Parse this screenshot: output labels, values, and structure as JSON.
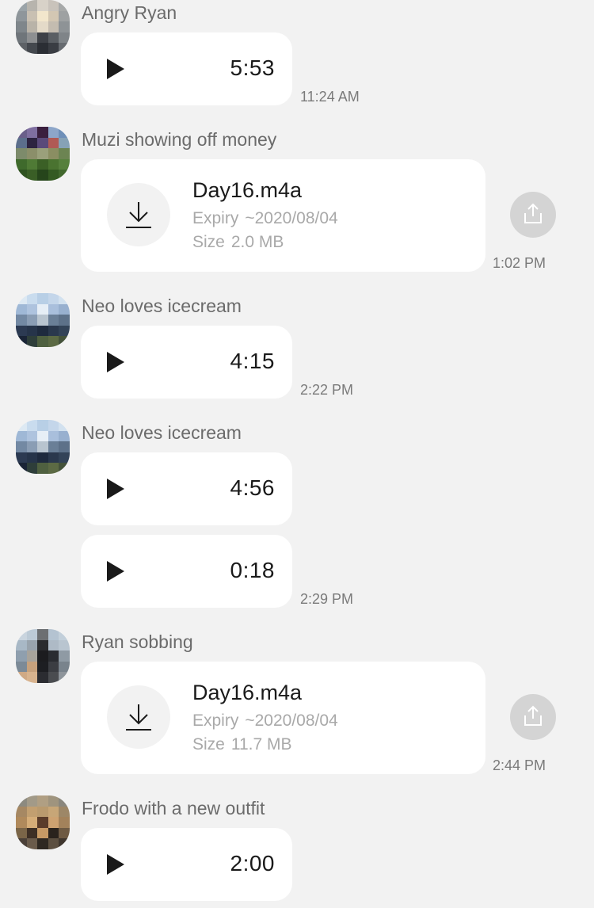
{
  "messages": [
    {
      "sender": "Angry Ryan",
      "duration": "5:53",
      "time": "11:24 AM"
    },
    {
      "sender": "Muzi showing off money",
      "file_name": "Day16.m4a",
      "expiry_label": "Expiry",
      "expiry_value": "~2020/08/04",
      "size_label": "Size",
      "size_value": "2.0 MB",
      "time": "1:02 PM"
    },
    {
      "sender": "Neo loves icecream",
      "duration": "4:15",
      "time": "2:22 PM"
    },
    {
      "sender": "Neo loves icecream",
      "duration_1": "4:56",
      "duration_2": "0:18",
      "time": "2:29 PM"
    },
    {
      "sender": "Ryan sobbing",
      "file_name": "Day16.m4a",
      "expiry_label": "Expiry",
      "expiry_value": "~2020/08/04",
      "size_label": "Size",
      "size_value": "11.7 MB",
      "time": "2:44 PM"
    },
    {
      "sender": "Frodo with a new outfit",
      "duration": "2:00"
    }
  ],
  "icons": {
    "play": "play-icon",
    "download": "download-icon",
    "share": "share-icon"
  },
  "colors": {
    "background": "#f2f2f2",
    "bubble": "#ffffff",
    "sender_text": "#6b6b6b",
    "meta_text": "#a9a9a9",
    "share_button": "#d4d4d4"
  }
}
